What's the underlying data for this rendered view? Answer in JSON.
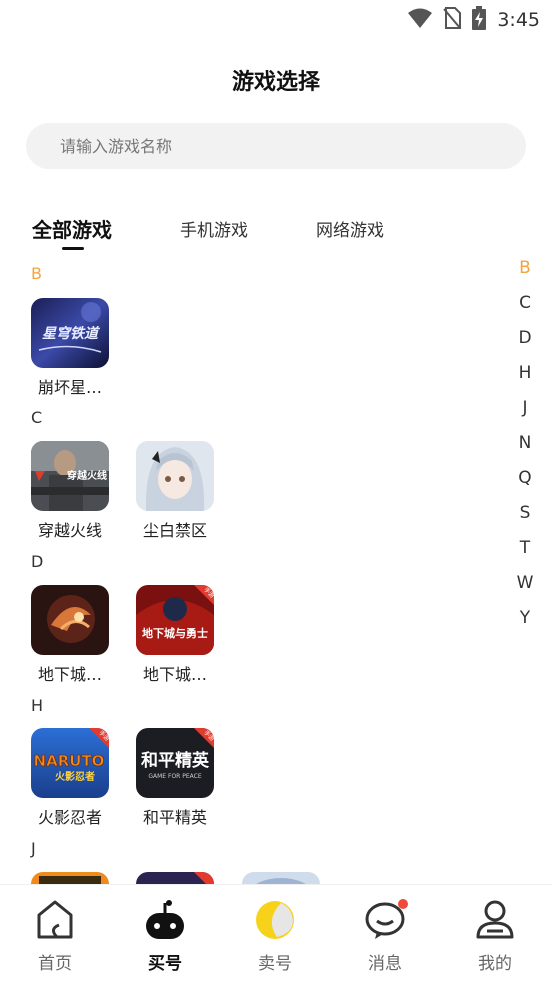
{
  "status_bar": {
    "time": "3:45"
  },
  "header": {
    "title": "游戏选择"
  },
  "search": {
    "placeholder": "请输入游戏名称"
  },
  "tabs": [
    {
      "label": "全部游戏",
      "active": true
    },
    {
      "label": "手机游戏",
      "active": false
    },
    {
      "label": "网络游戏",
      "active": false
    }
  ],
  "sections": [
    {
      "letter": "B",
      "games": [
        {
          "name": "崩坏星…",
          "icon": "honkai-star-rail-icon"
        }
      ]
    },
    {
      "letter": "C",
      "games": [
        {
          "name": "穿越火线",
          "icon": "crossfire-icon"
        },
        {
          "name": "尘白禁区",
          "icon": "snowbreak-icon"
        }
      ]
    },
    {
      "letter": "D",
      "games": [
        {
          "name": "地下城…",
          "icon": "dnf-icon"
        },
        {
          "name": "地下城…",
          "icon": "dnf-mobile-icon"
        }
      ]
    },
    {
      "letter": "H",
      "games": [
        {
          "name": "火影忍者",
          "icon": "naruto-icon"
        },
        {
          "name": "和平精英",
          "icon": "peace-elite-icon"
        }
      ]
    },
    {
      "letter": "J",
      "games": []
    }
  ],
  "icon_text": {
    "honkai": "星穹铁道",
    "crossfire": "穿越火线",
    "dnf_mobile": "地下城与勇士",
    "naruto": "NARUTO",
    "naruto_sub": "火影忍者",
    "peace_elite": "和平精英",
    "peace_elite_sub": "GAME FOR PEACE",
    "mobile_badge": "手游"
  },
  "alphabet_index": [
    "B",
    "C",
    "D",
    "H",
    "J",
    "N",
    "Q",
    "S",
    "T",
    "W",
    "Y"
  ],
  "alphabet_active": "B",
  "bottom_nav": [
    {
      "label": "首页",
      "icon": "home-icon",
      "active": false
    },
    {
      "label": "买号",
      "icon": "gamepad-icon",
      "active": true
    },
    {
      "label": "卖号",
      "icon": "sell-icon",
      "active": false
    },
    {
      "label": "消息",
      "icon": "message-icon",
      "active": false,
      "badge": true
    },
    {
      "label": "我的",
      "icon": "profile-icon",
      "active": false
    }
  ],
  "colors": {
    "accent": "#f5a33c",
    "badge": "#f04a3c",
    "sell_yellow": "#f7d21b"
  }
}
